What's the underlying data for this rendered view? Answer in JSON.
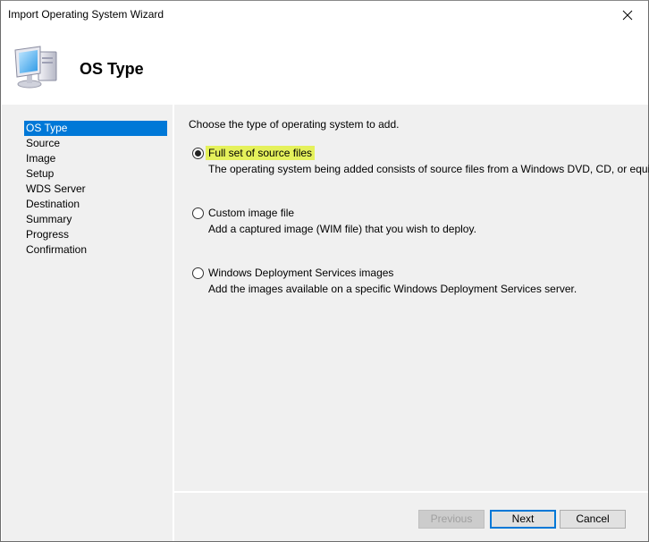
{
  "window": {
    "title": "Import Operating System Wizard",
    "close_icon": "close-icon"
  },
  "header": {
    "title": "OS Type",
    "icon": "computer-icon"
  },
  "sidebar": {
    "items": [
      {
        "label": "OS Type",
        "active": true
      },
      {
        "label": "Source",
        "active": false
      },
      {
        "label": "Image",
        "active": false
      },
      {
        "label": "Setup",
        "active": false
      },
      {
        "label": "WDS Server",
        "active": false
      },
      {
        "label": "Destination",
        "active": false
      },
      {
        "label": "Summary",
        "active": false
      },
      {
        "label": "Progress",
        "active": false
      },
      {
        "label": "Confirmation",
        "active": false
      }
    ]
  },
  "main": {
    "intro": "Choose the type of operating system to add.",
    "options": [
      {
        "label": "Full set of source files",
        "description": "The operating system being added consists of source files from a Windows DVD, CD, or equivalent.",
        "selected": true
      },
      {
        "label": "Custom image file",
        "description": "Add a captured image (WIM file) that you wish to deploy.",
        "selected": false
      },
      {
        "label": "Windows Deployment Services images",
        "description": "Add the images available on a specific Windows Deployment Services server.",
        "selected": false
      }
    ]
  },
  "footer": {
    "previous_label": "Previous",
    "next_label": "Next",
    "cancel_label": "Cancel"
  },
  "colors": {
    "accent": "#0078d7",
    "highlight": "#e5f15b",
    "panel_bg": "#f0f0f0"
  }
}
